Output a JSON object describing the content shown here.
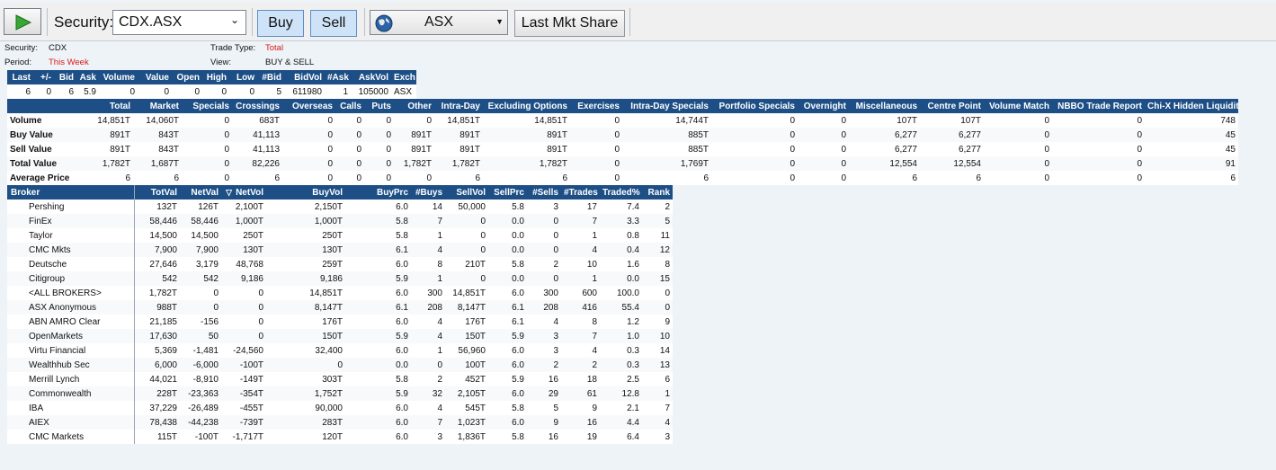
{
  "toolbar": {
    "security_label": "Security:",
    "security_value": "CDX.ASX",
    "buy_label": "Buy",
    "sell_label": "Sell",
    "exchange_value": "ASX",
    "last_mkt_share_label": "Last Mkt Share"
  },
  "info": {
    "security_label": "Security:",
    "security_value": "CDX",
    "period_label": "Period:",
    "period_value": "This Week",
    "trade_type_label": "Trade Type:",
    "trade_type_value": "Total",
    "view_label": "View:",
    "view_value": "BUY & SELL"
  },
  "quote": {
    "headers": [
      "Last",
      "+/-",
      "Bid",
      "Ask",
      "Volume",
      "Value",
      "Open",
      "High",
      "Low",
      "#Bid",
      "BidVol",
      "#Ask",
      "AskVol",
      "Exch"
    ],
    "values": [
      "6",
      "0",
      "6",
      "5.9",
      "0",
      "0",
      "0",
      "0",
      "0",
      "5",
      "611980",
      "1",
      "105000",
      "ASX"
    ]
  },
  "summary": {
    "headers": [
      "",
      "Total",
      "Market",
      "Specials",
      "Crossings",
      "Overseas",
      "Calls",
      "Puts",
      "Other",
      "Intra-Day",
      "Excluding Options",
      "Exercises",
      "Intra-Day Specials",
      "Portfolio Specials",
      "Overnight",
      "Miscellaneous",
      "Centre Point",
      "Volume Match",
      "NBBO Trade Report",
      "Chi-X Hidden Liquidity"
    ],
    "rows": [
      [
        "Volume",
        "14,851T",
        "14,060T",
        "0",
        "683T",
        "0",
        "0",
        "0",
        "0",
        "14,851T",
        "14,851T",
        "0",
        "14,744T",
        "0",
        "0",
        "107T",
        "107T",
        "0",
        "0",
        "748"
      ],
      [
        "Buy Value",
        "891T",
        "843T",
        "0",
        "41,113",
        "0",
        "0",
        "0",
        "891T",
        "891T",
        "891T",
        "0",
        "885T",
        "0",
        "0",
        "6,277",
        "6,277",
        "0",
        "0",
        "45"
      ],
      [
        "Sell Value",
        "891T",
        "843T",
        "0",
        "41,113",
        "0",
        "0",
        "0",
        "891T",
        "891T",
        "891T",
        "0",
        "885T",
        "0",
        "0",
        "6,277",
        "6,277",
        "0",
        "0",
        "45"
      ],
      [
        "Total Value",
        "1,782T",
        "1,687T",
        "0",
        "82,226",
        "0",
        "0",
        "0",
        "1,782T",
        "1,782T",
        "1,782T",
        "0",
        "1,769T",
        "0",
        "0",
        "12,554",
        "12,554",
        "0",
        "0",
        "91"
      ],
      [
        "Average Price",
        "6",
        "6",
        "0",
        "6",
        "0",
        "0",
        "0",
        "0",
        "6",
        "6",
        "0",
        "6",
        "0",
        "0",
        "6",
        "6",
        "0",
        "0",
        "6"
      ]
    ]
  },
  "brokers": {
    "headers": [
      "Broker",
      "TotVal",
      "NetVal",
      "NetVol",
      "BuyVol",
      "BuyPrc",
      "#Buys",
      "SellVol",
      "SellPrc",
      "#Sells",
      "#Trades",
      "Traded%",
      "Rank"
    ],
    "rows": [
      [
        "Pershing",
        "132T",
        "126T",
        "2,100T",
        "2,150T",
        "6.0",
        "14",
        "50,000",
        "5.8",
        "3",
        "17",
        "7.4",
        "2"
      ],
      [
        "FinEx",
        "58,446",
        "58,446",
        "1,000T",
        "1,000T",
        "5.8",
        "7",
        "0",
        "0.0",
        "0",
        "7",
        "3.3",
        "5"
      ],
      [
        "Taylor",
        "14,500",
        "14,500",
        "250T",
        "250T",
        "5.8",
        "1",
        "0",
        "0.0",
        "0",
        "1",
        "0.8",
        "11"
      ],
      [
        "CMC Mkts",
        "7,900",
        "7,900",
        "130T",
        "130T",
        "6.1",
        "4",
        "0",
        "0.0",
        "0",
        "4",
        "0.4",
        "12"
      ],
      [
        "Deutsche",
        "27,646",
        "3,179",
        "48,768",
        "259T",
        "6.0",
        "8",
        "210T",
        "5.8",
        "2",
        "10",
        "1.6",
        "8"
      ],
      [
        "Citigroup",
        "542",
        "542",
        "9,186",
        "9,186",
        "5.9",
        "1",
        "0",
        "0.0",
        "0",
        "1",
        "0.0",
        "15"
      ],
      [
        "<ALL BROKERS>",
        "1,782T",
        "0",
        "0",
        "14,851T",
        "6.0",
        "300",
        "14,851T",
        "6.0",
        "300",
        "600",
        "100.0",
        "0"
      ],
      [
        "ASX Anonymous",
        "988T",
        "0",
        "0",
        "8,147T",
        "6.1",
        "208",
        "8,147T",
        "6.1",
        "208",
        "416",
        "55.4",
        "0"
      ],
      [
        "ABN AMRO Clear",
        "21,185",
        "-156",
        "0",
        "176T",
        "6.0",
        "4",
        "176T",
        "6.1",
        "4",
        "8",
        "1.2",
        "9"
      ],
      [
        "OpenMarkets",
        "17,630",
        "50",
        "0",
        "150T",
        "5.9",
        "4",
        "150T",
        "5.9",
        "3",
        "7",
        "1.0",
        "10"
      ],
      [
        "Virtu Financial",
        "5,369",
        "-1,481",
        "-24,560",
        "32,400",
        "6.0",
        "1",
        "56,960",
        "6.0",
        "3",
        "4",
        "0.3",
        "14"
      ],
      [
        "Wealthhub Sec",
        "6,000",
        "-6,000",
        "-100T",
        "0",
        "0.0",
        "0",
        "100T",
        "6.0",
        "2",
        "2",
        "0.3",
        "13"
      ],
      [
        "Merrill Lynch",
        "44,021",
        "-8,910",
        "-149T",
        "303T",
        "5.8",
        "2",
        "452T",
        "5.9",
        "16",
        "18",
        "2.5",
        "6"
      ],
      [
        "Commonwealth",
        "228T",
        "-23,363",
        "-354T",
        "1,752T",
        "5.9",
        "32",
        "2,105T",
        "6.0",
        "29",
        "61",
        "12.8",
        "1"
      ],
      [
        "IBA",
        "37,229",
        "-26,489",
        "-455T",
        "90,000",
        "6.0",
        "4",
        "545T",
        "5.8",
        "5",
        "9",
        "2.1",
        "7"
      ],
      [
        "AIEX",
        "78,438",
        "-44,238",
        "-739T",
        "283T",
        "6.0",
        "7",
        "1,023T",
        "6.0",
        "9",
        "16",
        "4.4",
        "4"
      ],
      [
        "CMC Markets",
        "115T",
        "-100T",
        "-1,717T",
        "120T",
        "6.0",
        "3",
        "1,836T",
        "5.8",
        "16",
        "19",
        "6.4",
        "3"
      ]
    ]
  }
}
